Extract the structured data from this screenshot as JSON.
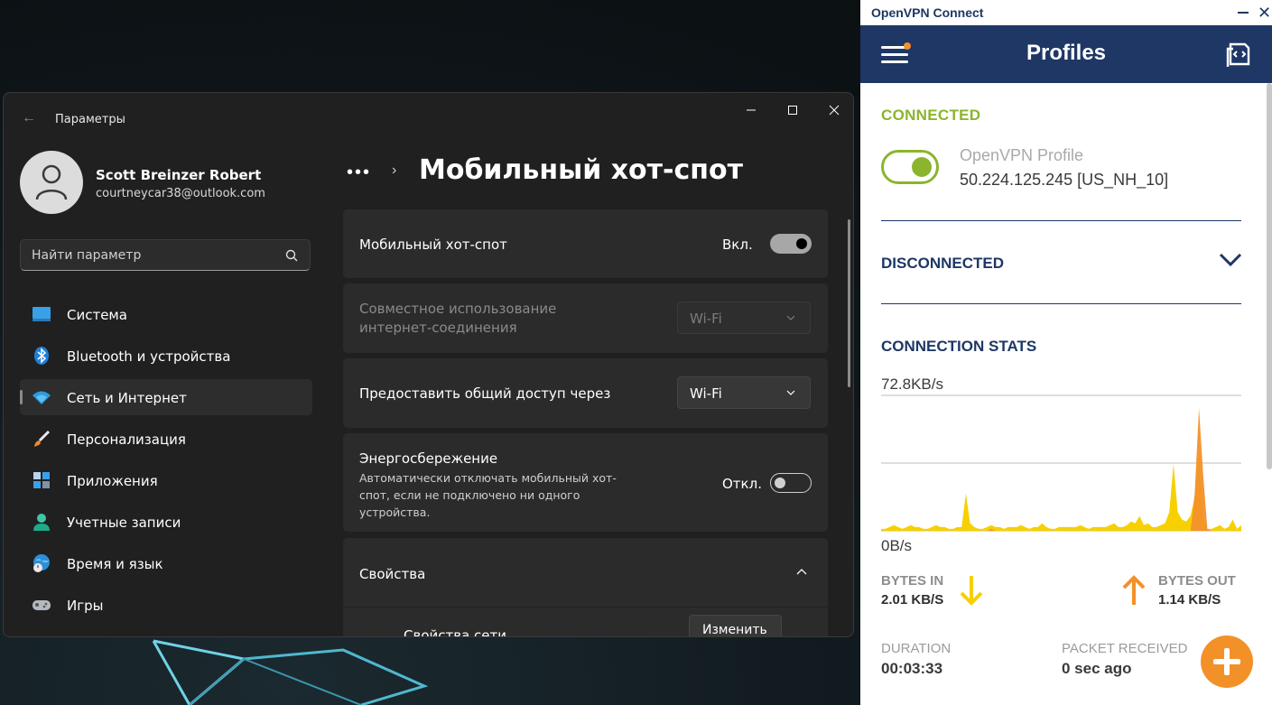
{
  "settings": {
    "app_title": "Параметры",
    "user": {
      "name": "Scott Breinzer Robert",
      "email": "courtneycar38@outlook.com"
    },
    "search_placeholder": "Найти параметр",
    "nav": [
      {
        "label": "Система",
        "icon": "monitor-icon",
        "active": false
      },
      {
        "label": "Bluetooth и устройства",
        "icon": "bluetooth-icon",
        "active": false
      },
      {
        "label": "Сеть и Интернет",
        "icon": "wifi-icon",
        "active": true
      },
      {
        "label": "Персонализация",
        "icon": "brush-icon",
        "active": false
      },
      {
        "label": "Приложения",
        "icon": "apps-icon",
        "active": false
      },
      {
        "label": "Учетные записи",
        "icon": "person-icon",
        "active": false
      },
      {
        "label": "Время и язык",
        "icon": "globe-clock-icon",
        "active": false
      },
      {
        "label": "Игры",
        "icon": "gamepad-icon",
        "active": false
      }
    ],
    "breadcrumb_more": "•••",
    "breadcrumb_sep": "›",
    "page_title": "Мобильный хот-спот",
    "hotspot": {
      "label": "Мобильный хот-спот",
      "state": "Вкл.",
      "on": true
    },
    "share_from": {
      "label": "Совместное использование интернет-соединения",
      "value": "Wi-Fi",
      "disabled": true
    },
    "share_over": {
      "label": "Предоставить общий доступ через",
      "value": "Wi-Fi"
    },
    "power_saving": {
      "label": "Энергосбережение",
      "description": "Автоматически отключать мобильный хот-спот, если не подключено ни одного устройства.",
      "state": "Откл.",
      "on": false
    },
    "properties": {
      "label": "Свойства",
      "expanded": true
    },
    "network_props": {
      "label": "Свойства сети",
      "button": "Изменить"
    }
  },
  "vpn": {
    "window_title": "OpenVPN Connect",
    "header_title": "Profiles",
    "connected_label": "CONNECTED",
    "profile_name": "OpenVPN Profile",
    "profile_server": "50.224.125.245 [US_NH_10]",
    "disconnected_label": "DISCONNECTED",
    "stats_label": "CONNECTION STATS",
    "bytes_in_label": "BYTES IN",
    "bytes_in_value": "2.01 KB/S",
    "bytes_out_label": "BYTES OUT",
    "bytes_out_value": "1.14 KB/S",
    "duration_label": "DURATION",
    "duration_value": "00:03:33",
    "packet_label": "PACKET RECEIVED",
    "packet_value": "0 sec ago",
    "colors": {
      "brand": "#1e3765",
      "connected": "#8bb52c",
      "accent": "#f39129",
      "bytes_in": "#f7d000"
    }
  },
  "chart_data": {
    "type": "area",
    "ylim_labels": [
      "0B/s",
      "72.8KB/s"
    ],
    "ylim": [
      0,
      72.8
    ],
    "y_unit": "KB/s",
    "series": [
      {
        "name": "BYTES IN",
        "color": "#f7d000",
        "values": [
          1,
          1,
          2,
          3,
          2,
          1,
          2,
          3,
          2,
          2,
          1,
          1,
          2,
          3,
          2,
          2,
          1,
          1,
          2,
          2,
          20,
          4,
          2,
          1,
          1,
          2,
          3,
          2,
          2,
          1,
          2,
          2,
          2,
          3,
          2,
          1,
          2,
          2,
          4,
          2,
          1,
          1,
          2,
          2,
          2,
          2,
          2,
          3,
          2,
          1,
          2,
          2,
          2,
          2,
          3,
          4,
          2,
          2,
          3,
          5,
          4,
          8,
          3,
          4,
          2,
          2,
          3,
          4,
          10,
          36,
          10,
          6,
          5,
          8,
          18,
          42,
          6,
          1,
          1,
          2,
          3,
          1,
          2,
          6,
          1,
          3
        ]
      },
      {
        "name": "BYTES OUT",
        "color": "#f39129",
        "values": [
          0,
          0,
          0,
          0,
          0,
          0,
          0,
          0,
          0,
          0,
          0,
          0,
          0,
          0,
          0,
          0,
          0,
          0,
          0,
          0,
          0,
          0,
          0,
          0,
          0,
          0,
          1,
          0,
          0,
          0,
          0,
          0,
          0,
          0,
          0,
          0,
          0,
          0,
          0,
          0,
          0,
          0,
          0,
          0,
          0,
          0,
          0,
          0,
          0,
          0,
          0,
          0,
          0,
          0,
          0,
          0,
          0,
          0,
          0,
          0,
          0,
          0,
          0,
          0,
          0,
          0,
          0,
          0,
          0,
          0,
          0,
          0,
          0,
          0,
          20,
          66,
          30,
          1,
          0,
          0,
          0,
          0,
          0,
          0,
          0,
          0
        ]
      }
    ]
  }
}
